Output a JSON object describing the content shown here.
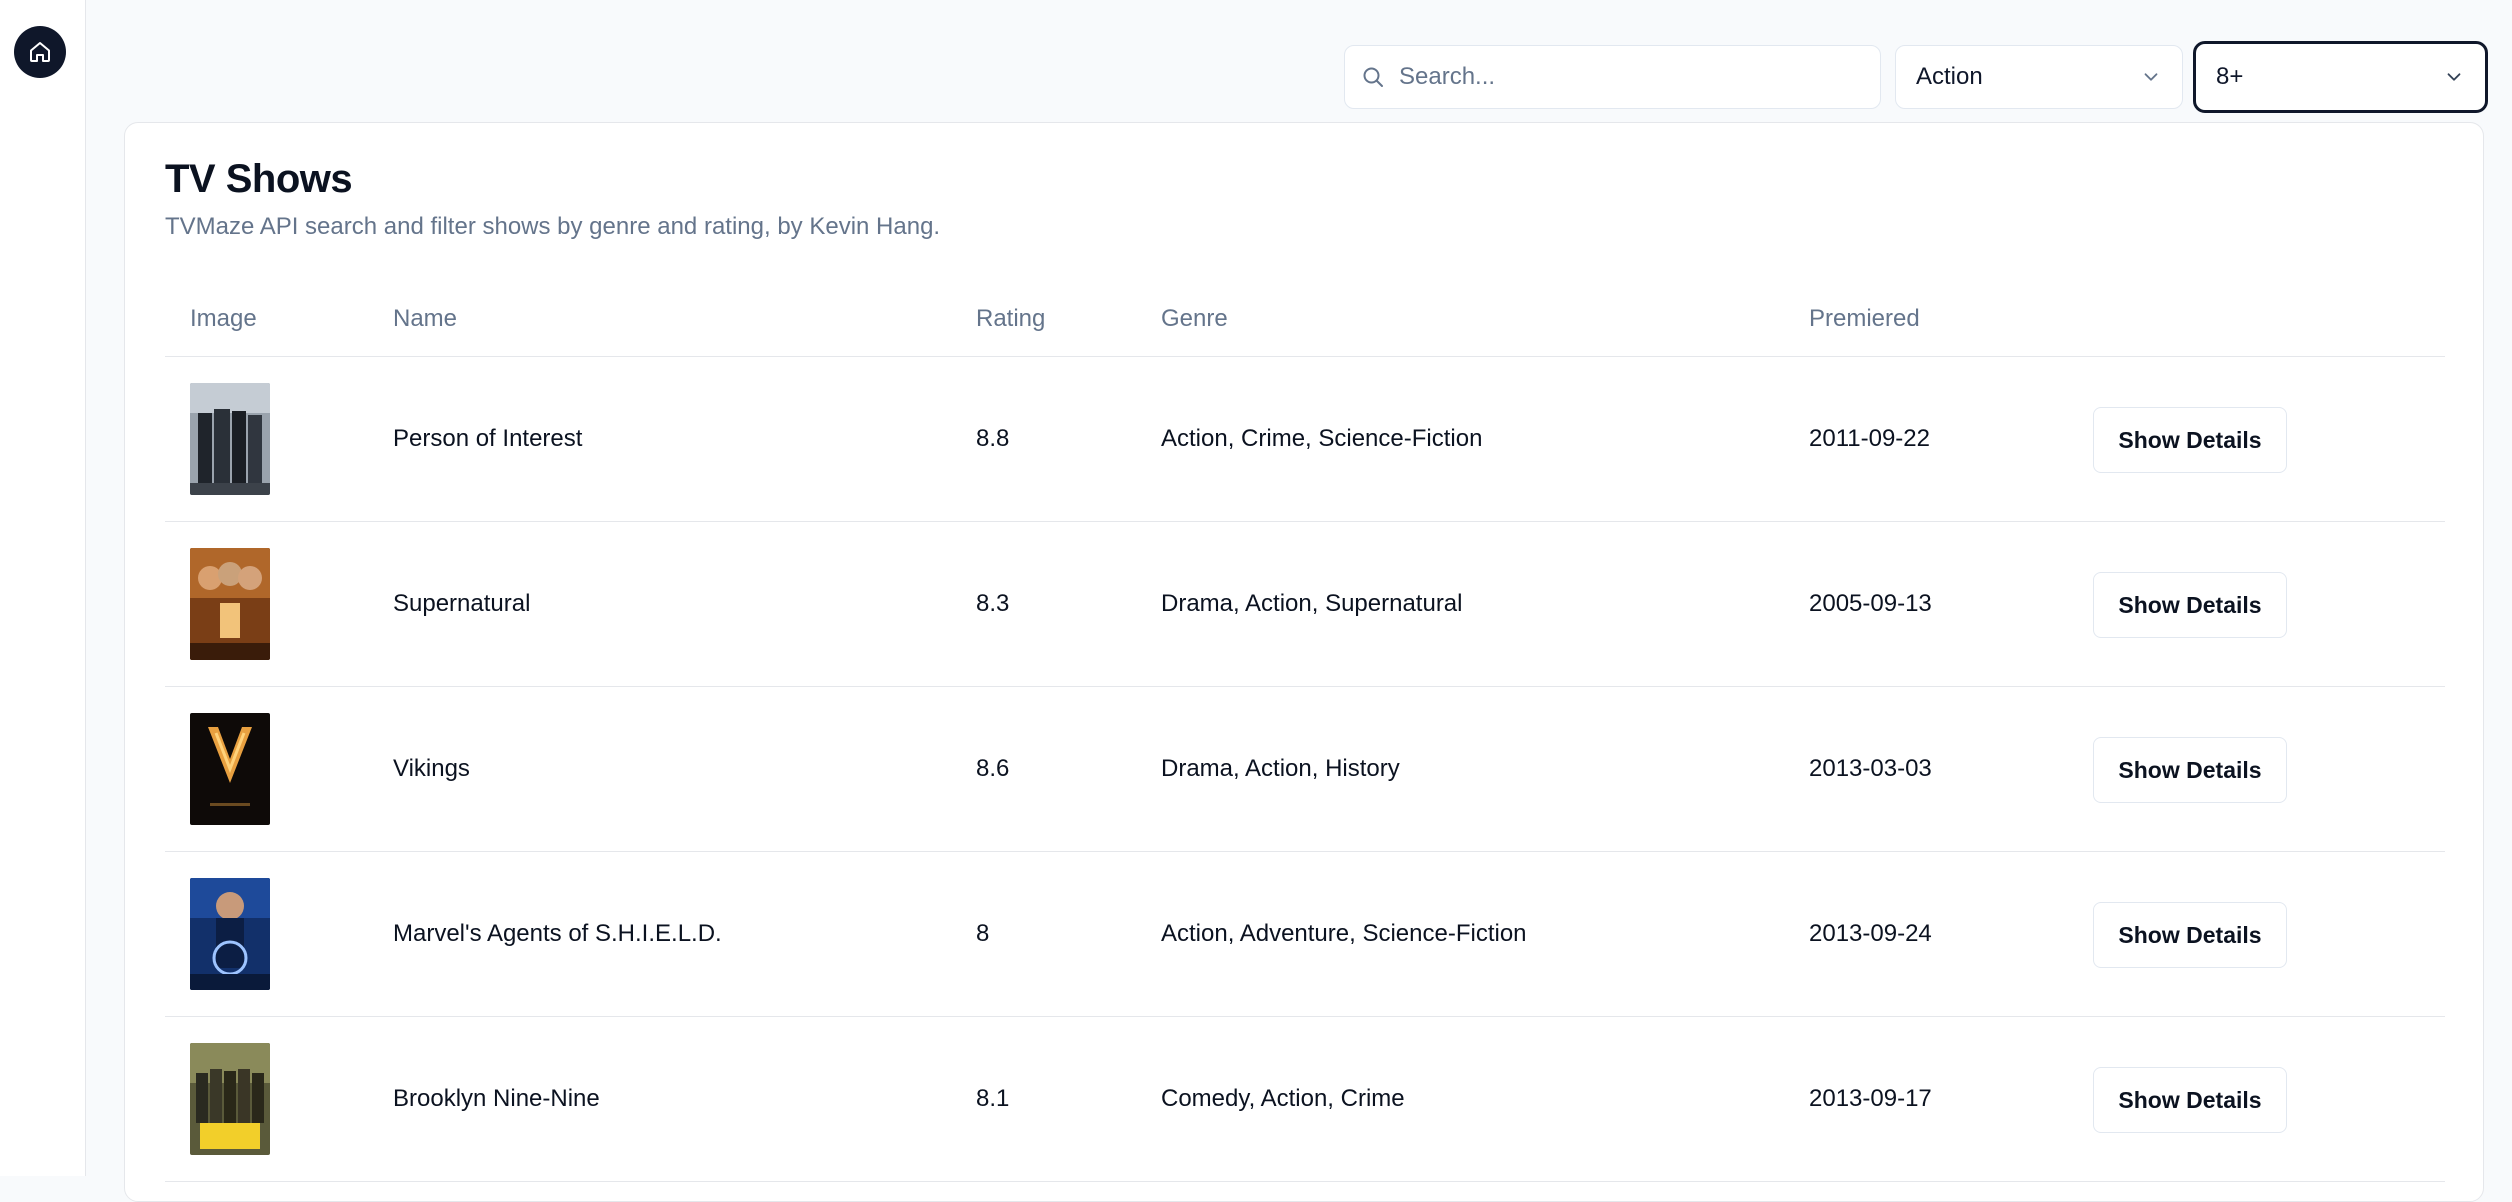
{
  "sidebar": {
    "home_icon": "home-icon"
  },
  "toolbar": {
    "search_placeholder": "Search...",
    "genre_select": "Action",
    "rating_select": "8+"
  },
  "page": {
    "title": "TV Shows",
    "subtitle": "TVMaze API search and filter shows by genre and rating, by Kevin Hang."
  },
  "table": {
    "headers": [
      "Image",
      "Name",
      "Rating",
      "Genre",
      "Premiered"
    ],
    "rows": [
      {
        "name": "Person of Interest",
        "rating": "8.8",
        "genre": "Action, Crime, Science-Fiction",
        "premiered": "2011-09-22",
        "button": "Show Details"
      },
      {
        "name": "Supernatural",
        "rating": "8.3",
        "genre": "Drama, Action, Supernatural",
        "premiered": "2005-09-13",
        "button": "Show Details"
      },
      {
        "name": "Vikings",
        "rating": "8.6",
        "genre": "Drama, Action, History",
        "premiered": "2013-03-03",
        "button": "Show Details"
      },
      {
        "name": "Marvel's Agents of S.H.I.E.L.D.",
        "rating": "8",
        "genre": "Action, Adventure, Science-Fiction",
        "premiered": "2013-09-24",
        "button": "Show Details"
      },
      {
        "name": "Brooklyn Nine-Nine",
        "rating": "8.1",
        "genre": "Comedy, Action, Crime",
        "premiered": "2013-09-17",
        "button": "Show Details"
      }
    ]
  }
}
